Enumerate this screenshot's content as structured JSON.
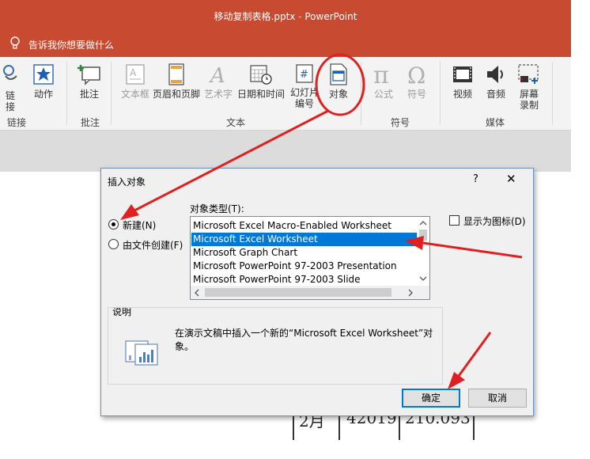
{
  "window": {
    "title": "移动复制表格.pptx  -  PowerPoint",
    "tell_me": "告诉我你想要做什么",
    "theme_color": "#c84b31"
  },
  "ribbon": {
    "groups": [
      {
        "label": "链接",
        "buttons": [
          "链\n接",
          "动作"
        ]
      },
      {
        "label": "批注",
        "buttons": [
          "批注"
        ]
      },
      {
        "label": "文本",
        "buttons": [
          "文本框",
          "页眉和页脚",
          "艺术字",
          "日期和时间",
          "幻灯片\n编号",
          "对象"
        ]
      },
      {
        "label": "符号",
        "buttons": [
          "公式",
          "符号"
        ]
      },
      {
        "label": "媒体",
        "buttons": [
          "视频",
          "音频",
          "屏幕\n录制"
        ]
      }
    ],
    "link_btn_l1": "链",
    "link_btn_l2": "接",
    "action_btn": "动作",
    "comment_btn": "批注",
    "textbox_btn": "文本框",
    "header_footer_btn": "页眉和页脚",
    "wordart_btn": "艺术字",
    "datetime_btn": "日期和时间",
    "slidenum_btn_l1": "幻灯片",
    "slidenum_btn_l2": "编号",
    "object_btn": "对象",
    "equation_btn": "公式",
    "symbol_btn": "符号",
    "video_btn": "视频",
    "audio_btn": "音频",
    "screenrec_btn_l1": "屏幕",
    "screenrec_btn_l2": "录制",
    "group_links": "链接",
    "group_comments": "批注",
    "group_text": "文本",
    "group_symbols": "符号",
    "group_media": "媒体"
  },
  "dialog": {
    "title": "插入对象",
    "help": "?",
    "close": "✕",
    "radio_new": "新建(N)",
    "radio_from_file": "由文件创建(F)",
    "object_type_label": "对象类型(T):",
    "object_types": [
      "Microsoft Excel Macro-Enabled Worksheet",
      "Microsoft Excel Worksheet",
      "Microsoft Graph Chart",
      "Microsoft PowerPoint 97-2003 Presentation",
      "Microsoft PowerPoint 97-2003 Slide"
    ],
    "selected_index": 1,
    "display_as_icon": "显示为图标(D)",
    "description_group": "说明",
    "description_text_l1": "在演示文稿中插入一个新的“Microsoft Excel Worksheet”对",
    "description_text_l2": "象。",
    "ok": "确定",
    "cancel": "取消"
  },
  "slide_table_fragment": {
    "c1": "2月",
    "c2": "42019",
    "c3": "210.093"
  },
  "annotation_color": "#e02020"
}
